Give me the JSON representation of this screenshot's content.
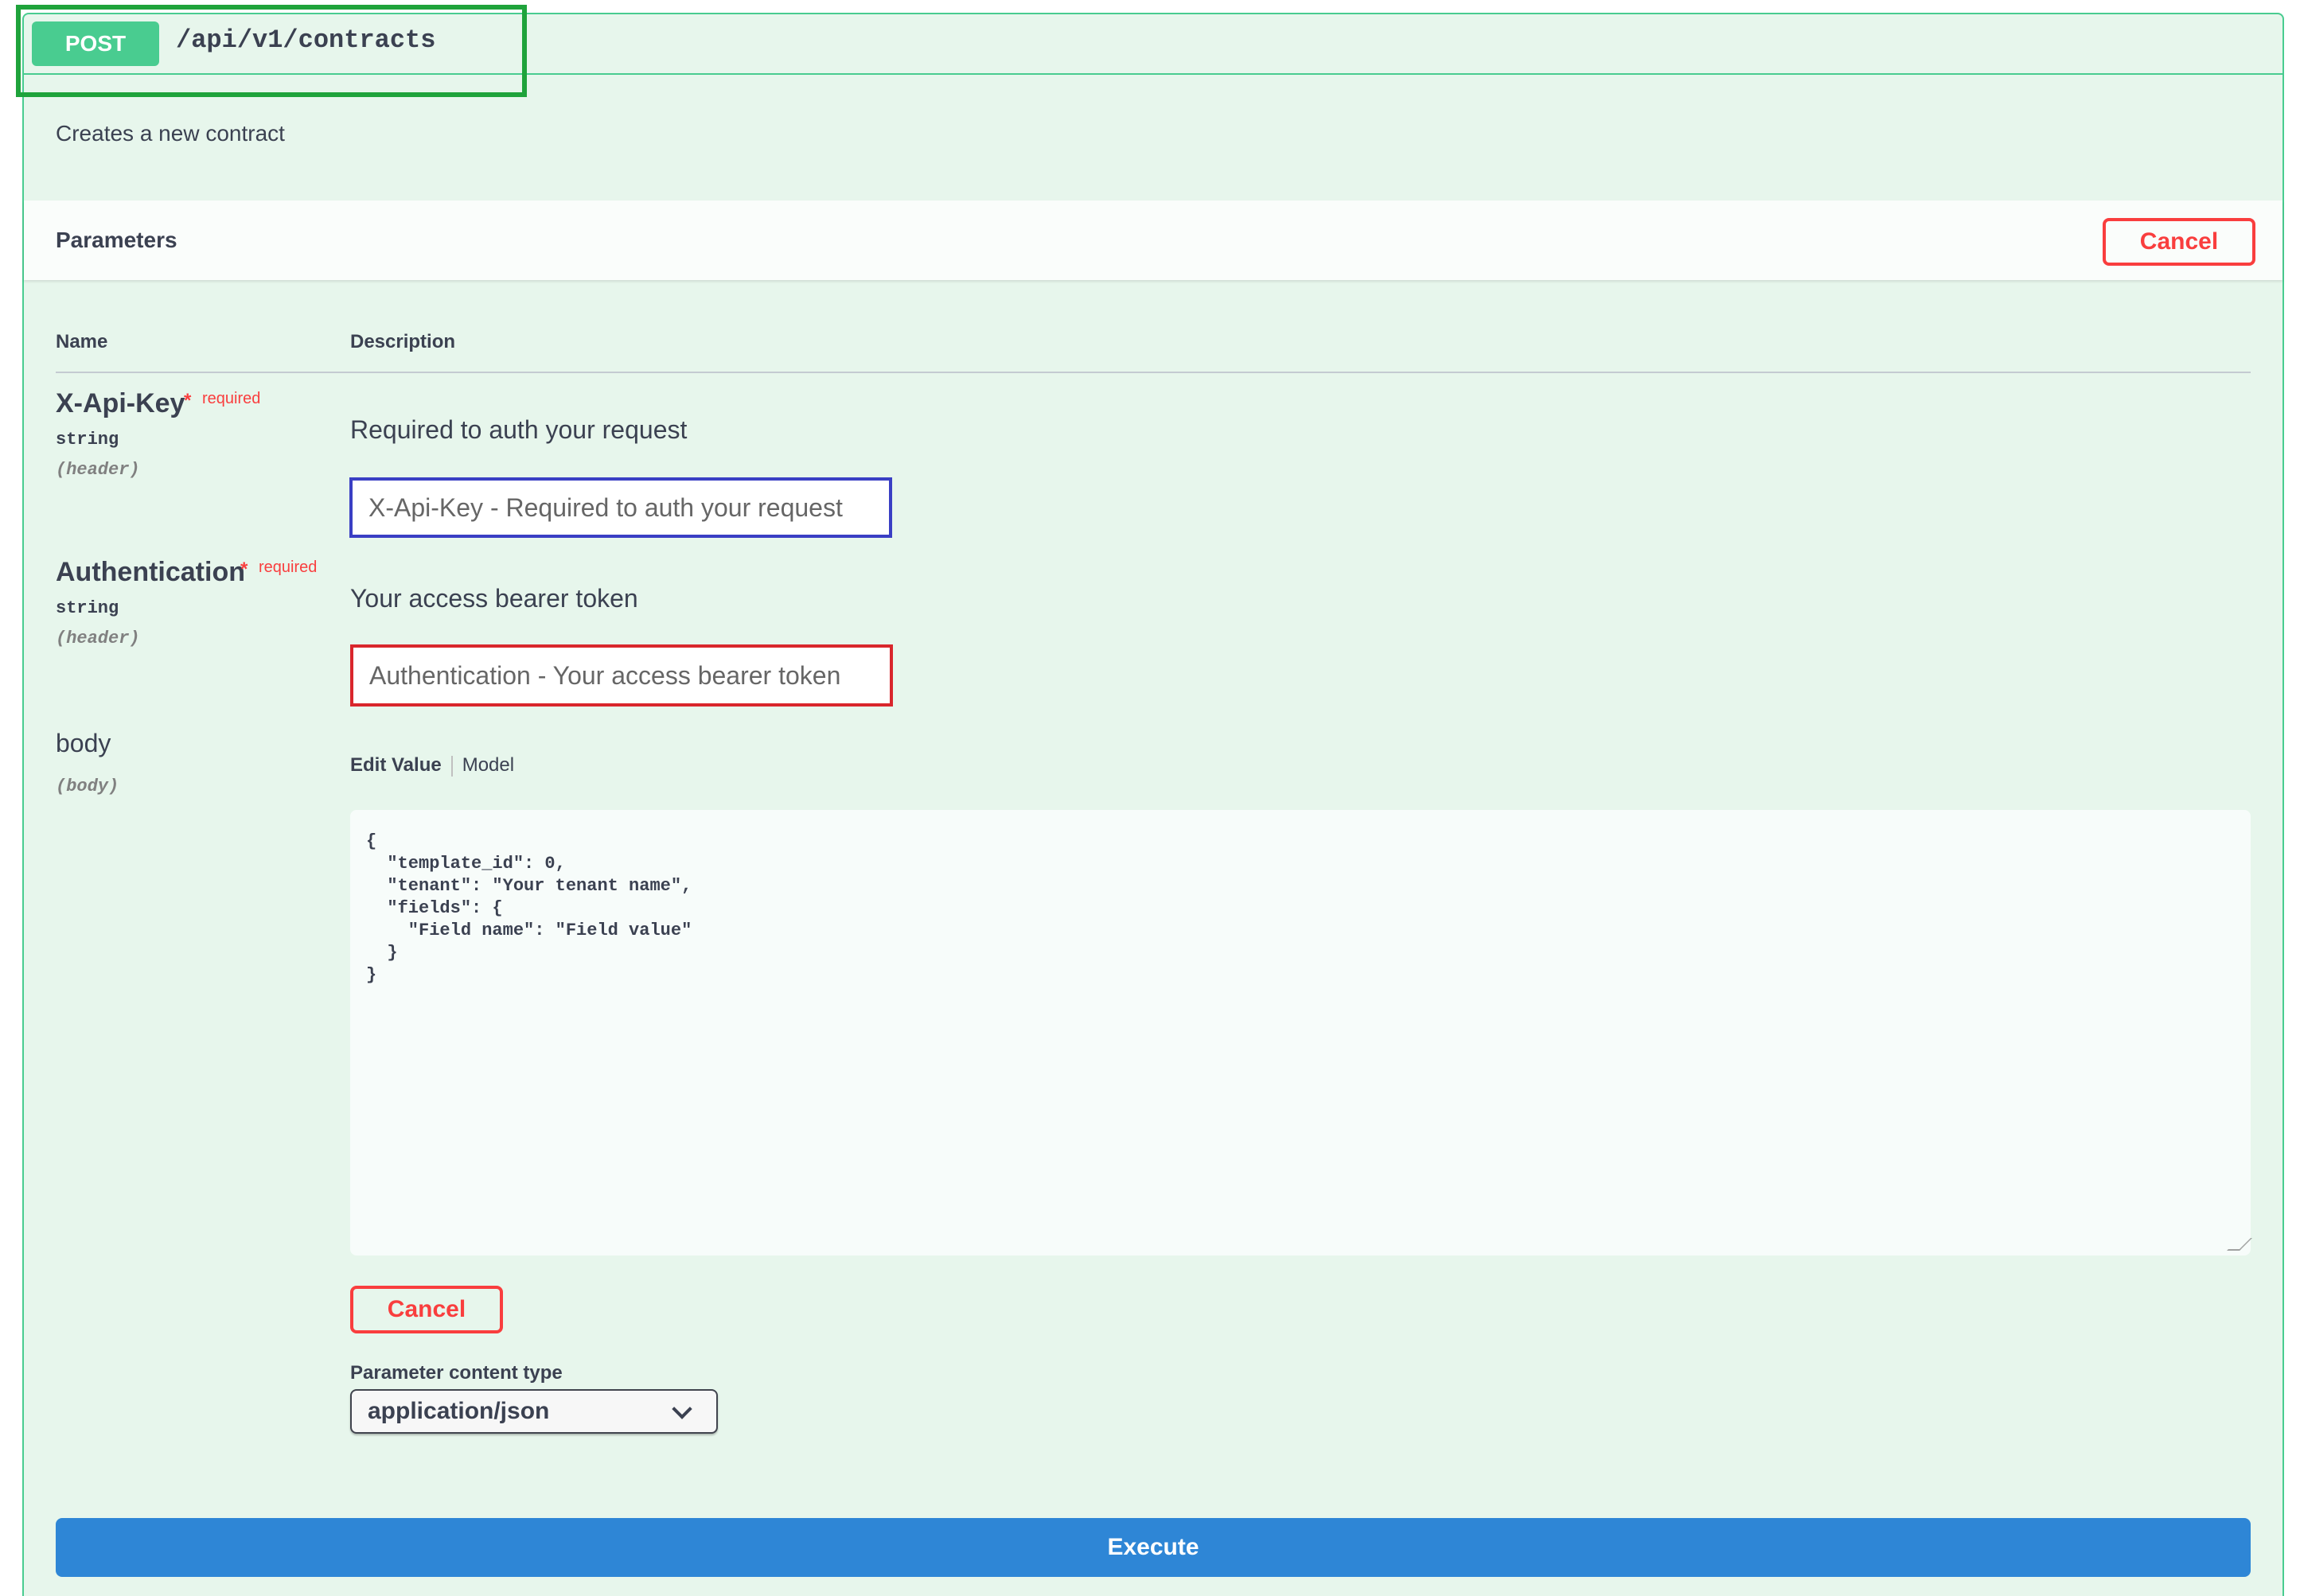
{
  "operation": {
    "method": "POST",
    "path": "/api/v1/contracts",
    "description": "Creates a new contract"
  },
  "parameters": {
    "title": "Parameters",
    "cancel_label": "Cancel",
    "columns": {
      "name": "Name",
      "description": "Description"
    },
    "required_star": "*",
    "required_text": "required",
    "items": [
      {
        "name": "X-Api-Key",
        "type": "string",
        "in": "(header)",
        "description": "Required to auth your request",
        "placeholder": "X-Api-Key - Required to auth your request"
      },
      {
        "name": "Authentication",
        "type": "string",
        "in": "(header)",
        "description": "Your access bearer token",
        "placeholder": "Authentication - Your access bearer token"
      }
    ],
    "body": {
      "name": "body",
      "in": "(body)",
      "tab_edit": "Edit Value",
      "tab_model": "Model",
      "value": "{\n  \"template_id\": 0,\n  \"tenant\": \"Your tenant name\",\n  \"fields\": {\n    \"Field name\": \"Field value\"\n  }\n}",
      "cancel_label": "Cancel"
    },
    "content_type_label": "Parameter content type",
    "content_type_value": "application/json"
  },
  "execute_label": "Execute",
  "colors": {
    "post": "#49cc90",
    "cancel": "#f93e3e",
    "execute": "#2e86d6",
    "highlight_green": "#1fa33b",
    "highlight_blue": "#3a3fc4",
    "highlight_red": "#d9262c"
  }
}
